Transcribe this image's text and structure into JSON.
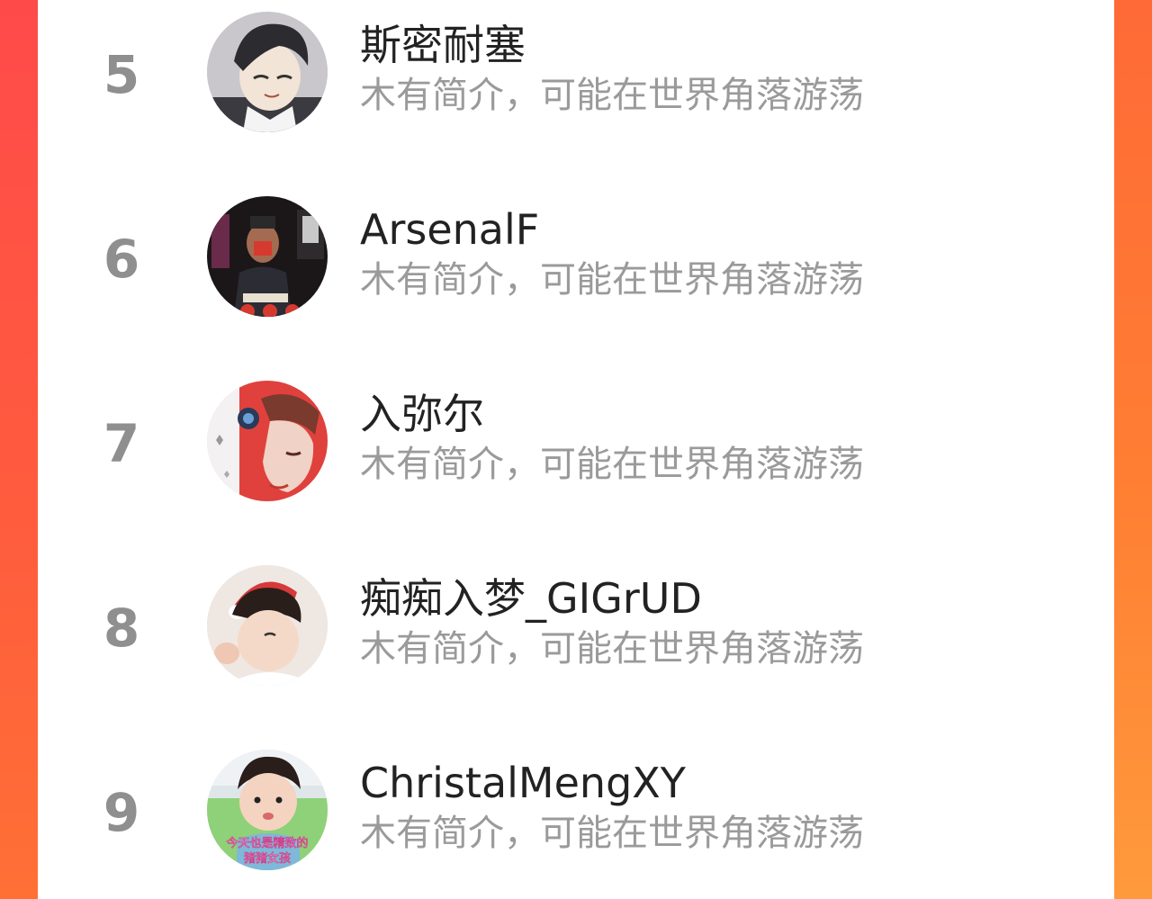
{
  "colors": {
    "accent_left": "#ff4a4a",
    "accent_right": "#ff8a35",
    "rank": "#8f8f8f",
    "name": "#222222",
    "desc": "#9a9a9a"
  },
  "ranking": [
    {
      "rank": "5",
      "name": "斯密耐塞",
      "desc": "木有简介，可能在世界角落游荡",
      "avatar": "anime-boy-avatar"
    },
    {
      "rank": "6",
      "name": "ArsenalF",
      "desc": "木有简介，可能在世界角落游荡",
      "avatar": "masked-person-avatar"
    },
    {
      "rank": "7",
      "name": "入弥尔",
      "desc": "木有简介，可能在世界角落游荡",
      "avatar": "illustrated-boy-avatar"
    },
    {
      "rank": "8",
      "name": "痴痴入梦_GIGrUD",
      "desc": "木有简介，可能在世界角落游荡",
      "avatar": "santa-hat-child-avatar"
    },
    {
      "rank": "9",
      "name": "ChristalMengXY",
      "desc": "木有简介，可能在世界角落游荡",
      "avatar": "toddler-girl-avatar",
      "avatar_caption": [
        "今天也是精致的",
        "猪猪女孩"
      ]
    }
  ]
}
